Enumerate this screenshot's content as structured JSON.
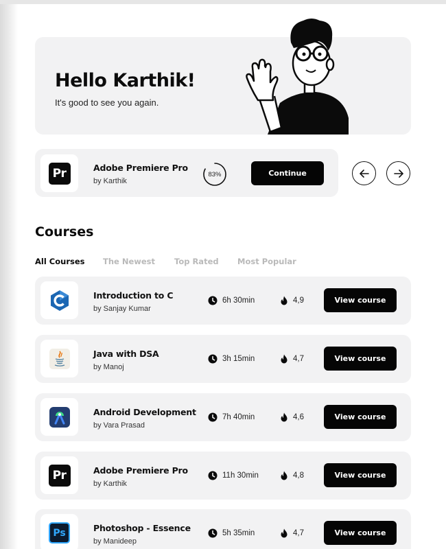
{
  "hero": {
    "greeting": "Hello Karthik!",
    "subtitle": "It's good to see you again."
  },
  "continue_card": {
    "logo": "Pr",
    "title": "Adobe Premiere Pro",
    "author": "by Karthik",
    "progress_percent": 83,
    "progress_label": "83%",
    "button_label": "Continue",
    "prev_icon": "arrow-left-icon",
    "next_icon": "arrow-right-icon"
  },
  "courses": {
    "title": "Courses",
    "tabs": [
      {
        "label": "All Courses",
        "active": true
      },
      {
        "label": "The Newest",
        "active": false
      },
      {
        "label": "Top Rated",
        "active": false
      },
      {
        "label": "Most Popular",
        "active": false
      }
    ],
    "items": [
      {
        "logo": "c-language-icon",
        "title": "Introduction to C",
        "author": "by Sanjay Kumar",
        "duration": "6h 30min",
        "rating": "4,9",
        "button": "View course"
      },
      {
        "logo": "java-icon",
        "title": "Java with DSA",
        "author": "by Manoj",
        "duration": "3h 15min",
        "rating": "4,7",
        "button": "View course"
      },
      {
        "logo": "android-studio-icon",
        "title": "Android Development",
        "author": "by Vara Prasad",
        "duration": "7h 40min",
        "rating": "4,6",
        "button": "View course"
      },
      {
        "logo": "Pr",
        "title": "Adobe Premiere Pro",
        "author": "by Karthik",
        "duration": "11h 30min",
        "rating": "4,8",
        "button": "View course"
      },
      {
        "logo": "Ps",
        "title": "Photoshop - Essence",
        "author": "by Manideep",
        "duration": "5h 35min",
        "rating": "4,7",
        "button": "View course"
      }
    ]
  },
  "colors": {
    "card_bg": "#f2f2f3",
    "button_bg": "#050505",
    "tab_inactive": "#b9b9b9",
    "photoshop_blue": "#31a8ff"
  }
}
